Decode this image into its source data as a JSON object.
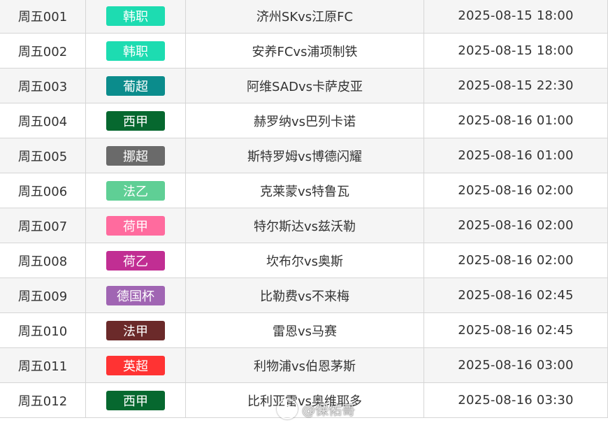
{
  "rows": [
    {
      "id": "周五001",
      "league": "韩职",
      "color": "#1ddcb1",
      "match": "济州SKvs江原FC",
      "time": "2025-08-15 18:00"
    },
    {
      "id": "周五002",
      "league": "韩职",
      "color": "#1ddcb1",
      "match": "安养FCvs浦项制铁",
      "time": "2025-08-15 18:00"
    },
    {
      "id": "周五003",
      "league": "葡超",
      "color": "#0b8c8c",
      "match": "阿维SADvs卡萨皮亚",
      "time": "2025-08-15 22:30"
    },
    {
      "id": "周五004",
      "league": "西甲",
      "color": "#06682f",
      "match": "赫罗纳vs巴列卡诺",
      "time": "2025-08-16 01:00"
    },
    {
      "id": "周五005",
      "league": "挪超",
      "color": "#6a6a6a",
      "match": "斯特罗姆vs博德闪耀",
      "time": "2025-08-16 01:00"
    },
    {
      "id": "周五006",
      "league": "法乙",
      "color": "#5fcf95",
      "match": "克莱蒙vs特鲁瓦",
      "time": "2025-08-16 02:00"
    },
    {
      "id": "周五007",
      "league": "荷甲",
      "color": "#ff6b9e",
      "match": "特尔斯达vs兹沃勒",
      "time": "2025-08-16 02:00"
    },
    {
      "id": "周五008",
      "league": "荷乙",
      "color": "#c12e93",
      "match": "坎布尔vs奥斯",
      "time": "2025-08-16 02:00"
    },
    {
      "id": "周五009",
      "league": "德国杯",
      "color": "#a065b3",
      "match": "比勒费vs不来梅",
      "time": "2025-08-16 02:45"
    },
    {
      "id": "周五010",
      "league": "法甲",
      "color": "#6b2a2a",
      "match": "雷恩vs马赛",
      "time": "2025-08-16 02:45"
    },
    {
      "id": "周五011",
      "league": "英超",
      "color": "#ff3333",
      "match": "利物浦vs伯恩茅斯",
      "time": "2025-08-16 03:00"
    },
    {
      "id": "周五012",
      "league": "西甲",
      "color": "#06682f",
      "match": "比利亚雷vs奥维耶多",
      "time": "2025-08-16 03:30"
    }
  ],
  "watermark": {
    "icon": "weibo-icon",
    "text": "@保佑哥"
  }
}
